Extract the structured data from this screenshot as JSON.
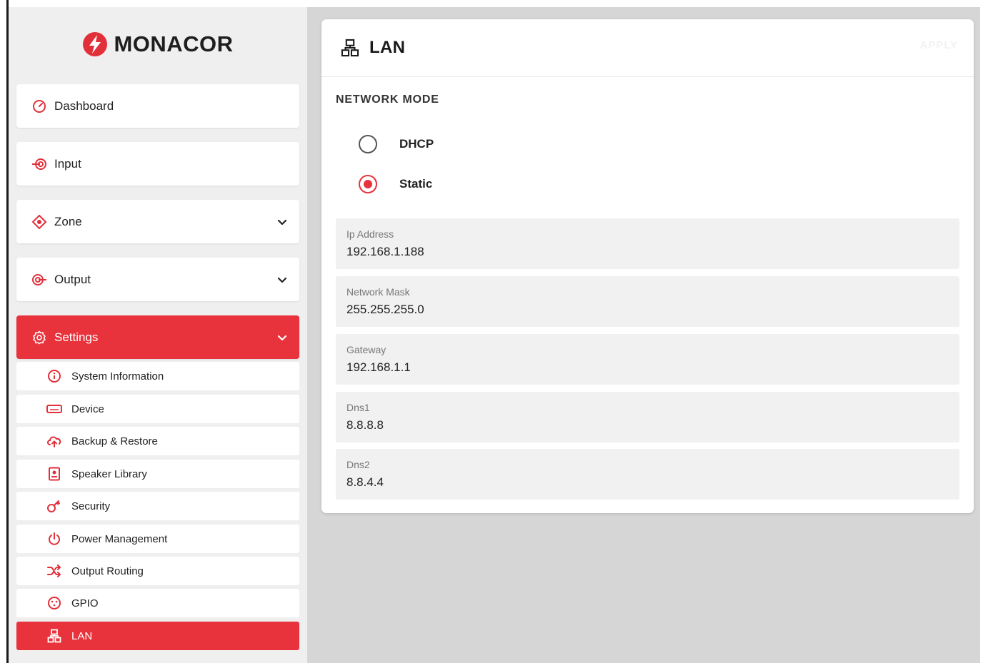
{
  "brand": {
    "name": "MONACOR",
    "accent": "#e8323c"
  },
  "sidebar": {
    "items": [
      {
        "label": "Dashboard",
        "icon": "gauge-icon"
      },
      {
        "label": "Input",
        "icon": "input-icon"
      },
      {
        "label": "Zone",
        "icon": "zone-icon"
      },
      {
        "label": "Output",
        "icon": "output-icon"
      },
      {
        "label": "Settings",
        "icon": "gear-icon"
      }
    ],
    "settings_items": [
      {
        "label": "System Information",
        "icon": "info-icon"
      },
      {
        "label": "Device",
        "icon": "device-icon"
      },
      {
        "label": "Backup & Restore",
        "icon": "cloud-upload-icon"
      },
      {
        "label": "Speaker Library",
        "icon": "book-icon"
      },
      {
        "label": "Security",
        "icon": "key-icon"
      },
      {
        "label": "Power Management",
        "icon": "power-icon"
      },
      {
        "label": "Output Routing",
        "icon": "shuffle-icon"
      },
      {
        "label": "GPIO",
        "icon": "gpio-icon"
      },
      {
        "label": "LAN",
        "icon": "network-icon"
      }
    ]
  },
  "card": {
    "title": "LAN",
    "apply_label": "APPLY",
    "network_mode_label": "NETWORK MODE",
    "modes": [
      {
        "label": "DHCP",
        "checked": false
      },
      {
        "label": "Static",
        "checked": true
      }
    ],
    "fields": [
      {
        "label": "Ip Address",
        "value": "192.168.1.188"
      },
      {
        "label": "Network Mask",
        "value": "255.255.255.0"
      },
      {
        "label": "Gateway",
        "value": "192.168.1.1"
      },
      {
        "label": "Dns1",
        "value": "8.8.8.8"
      },
      {
        "label": "Dns2",
        "value": "8.8.4.4"
      }
    ]
  }
}
